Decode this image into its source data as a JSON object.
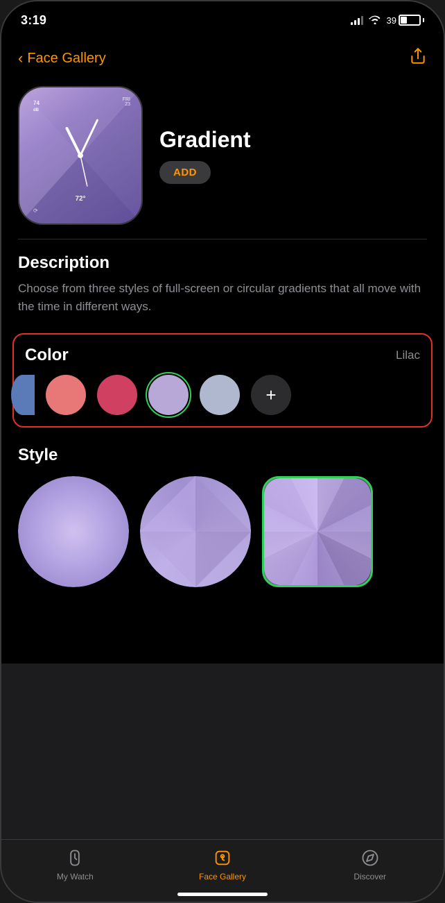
{
  "status_bar": {
    "time": "3:19",
    "battery_percent": "39"
  },
  "nav": {
    "back_label": "Face Gallery",
    "share_icon": "share"
  },
  "watch": {
    "name": "Gradient",
    "add_button": "ADD"
  },
  "description": {
    "title": "Description",
    "body": "Choose from three styles of full-screen or circular gradients that all move with the time in different ways."
  },
  "color": {
    "title": "Color",
    "current": "Lilac",
    "swatches": [
      {
        "id": "blue",
        "label": "Blue",
        "selected": false,
        "partial": true
      },
      {
        "id": "pink",
        "label": "Pink",
        "selected": false
      },
      {
        "id": "rose",
        "label": "Rose",
        "selected": false
      },
      {
        "id": "lilac",
        "label": "Lilac",
        "selected": true
      },
      {
        "id": "lavender",
        "label": "Lavender",
        "selected": false
      },
      {
        "id": "add",
        "label": "Add",
        "selected": false
      }
    ]
  },
  "style": {
    "title": "Style",
    "options": [
      {
        "id": "full",
        "label": "Full Screen",
        "selected": false
      },
      {
        "id": "circular",
        "label": "Circular",
        "selected": false
      },
      {
        "id": "multi",
        "label": "Multi",
        "selected": true
      }
    ]
  },
  "tab_bar": {
    "tabs": [
      {
        "id": "my-watch",
        "label": "My Watch",
        "active": false
      },
      {
        "id": "face-gallery",
        "label": "Face Gallery",
        "active": true
      },
      {
        "id": "discover",
        "label": "Discover",
        "active": false
      }
    ]
  }
}
